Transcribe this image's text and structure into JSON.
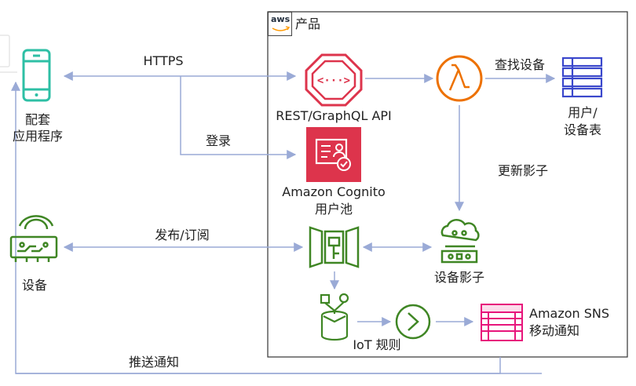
{
  "container": {
    "title": "产品"
  },
  "aws_logo_text": "aws",
  "nodes": {
    "companion_app": {
      "line1": "配套",
      "line2": "应用程序"
    },
    "device": {
      "label": "设备"
    },
    "rest_api": {
      "label": "REST/GraphQL API"
    },
    "cognito": {
      "line1": "Amazon Cognito",
      "line2": "用户池"
    },
    "lambda": {
      "label": ""
    },
    "table": {
      "line1": "用户/",
      "line2": "设备表"
    },
    "device_shadow": {
      "label": "设备影子"
    },
    "iot_rule": {
      "label": "IoT 规则"
    },
    "sns": {
      "line1": "Amazon SNS",
      "line2": "移动通知"
    }
  },
  "edges": {
    "https": "HTTPS",
    "login": "登录",
    "lookup": "查找设备",
    "update_shadow": "更新影子",
    "pubsub": "发布/订阅",
    "push": "推送通知"
  },
  "colors": {
    "teal": "#2ebfa5",
    "green": "#3f8624",
    "red": "#dd344c",
    "orange": "#ed7100",
    "blue": "#3b48cc",
    "pink": "#e7157b",
    "arrow": "#9aaad6",
    "border": "#333333"
  }
}
